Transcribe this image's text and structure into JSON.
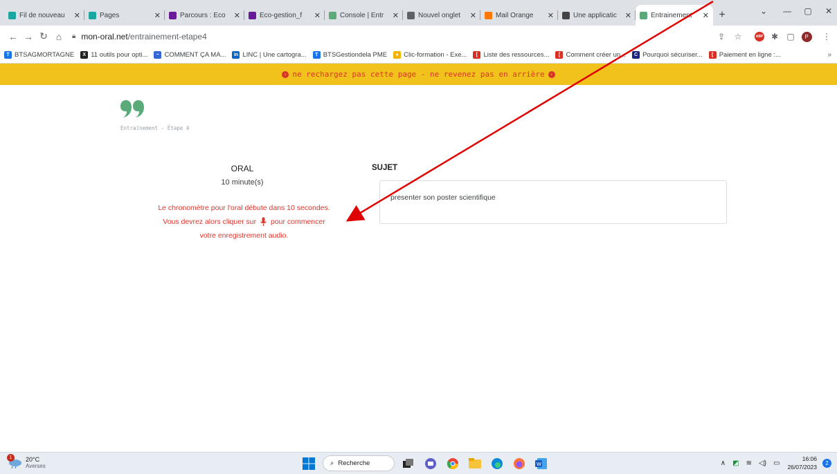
{
  "browser": {
    "tabs": [
      {
        "title": "Fil de nouveau",
        "icon": "page-icon",
        "color": "#1aa7a1"
      },
      {
        "title": "Pages",
        "icon": "page-icon",
        "color": "#1aa7a1"
      },
      {
        "title": "Parcours : Eco",
        "icon": "m-icon",
        "color": "#6a1b9a"
      },
      {
        "title": "Eco-gestion_f",
        "icon": "m-icon",
        "color": "#6a1b9a"
      },
      {
        "title": "Console | Entr",
        "icon": "quote-icon",
        "color": "#5bab7a"
      },
      {
        "title": "Nouvel onglet",
        "icon": "chrome-icon",
        "color": "#5f6368"
      },
      {
        "title": "Mail Orange",
        "icon": "mail-icon",
        "color": "#ff7900"
      },
      {
        "title": "Une applicatic",
        "icon": "app-icon",
        "color": "#444444"
      },
      {
        "title": "Entrainement",
        "icon": "quote-icon",
        "color": "#5bab7a",
        "active": true
      }
    ],
    "address": {
      "domain": "mon-oral.net",
      "path": "/entrainement-etape4"
    },
    "bookmarks": [
      {
        "label": "BTSAGMORTAGNE",
        "color": "#1a73e8",
        "glyph": "T"
      },
      {
        "label": "11 outils pour opti...",
        "color": "#222222",
        "glyph": "X"
      },
      {
        "label": "COMMENT ÇA MA...",
        "color": "#3367d6",
        "glyph": "~"
      },
      {
        "label": "LINC | Une cartogra...",
        "color": "#0a66c2",
        "glyph": "in"
      },
      {
        "label": "BTSGestiondela PME",
        "color": "#1a73e8",
        "glyph": "T"
      },
      {
        "label": "Clic-formation - Exe...",
        "color": "#f4b400",
        "glyph": "●"
      },
      {
        "label": "Liste des ressources...",
        "color": "#d93025",
        "glyph": "["
      },
      {
        "label": "Comment créer un...",
        "color": "#d93025",
        "glyph": "["
      },
      {
        "label": "Pourquoi sécuriser...",
        "color": "#1a237e",
        "glyph": "C"
      },
      {
        "label": "Paiement en ligne :...",
        "color": "#d93025",
        "glyph": "["
      }
    ],
    "bookmarks_more": "»",
    "profile_initial": "P"
  },
  "banner": {
    "text": "ne rechargez pas cette page - ne revenez pas en arrière"
  },
  "page": {
    "stage": "Entraînement - Étape 4",
    "oral": {
      "title": "ORAL",
      "duration": "10 minute(s)"
    },
    "warning": {
      "line1": "Le chronomètre pour l'oral débute dans 10 secondes.",
      "line2_before": "Vous devrez alors cliquer sur",
      "line2_after": "pour commencer",
      "line3": "votre enregistrement audio."
    },
    "sujet": {
      "title": "SUJET",
      "text": "presenter son poster scientifique"
    }
  },
  "taskbar": {
    "weather": {
      "temp": "20°C",
      "desc": "Averses",
      "badge": "1"
    },
    "search": "Recherche",
    "time": "16:06",
    "date": "26/07/2023",
    "notifications": "2"
  },
  "colors": {
    "accent_red": "#e0342b",
    "banner_yellow": "#f1c21b",
    "logo_green": "#5bab7a"
  }
}
